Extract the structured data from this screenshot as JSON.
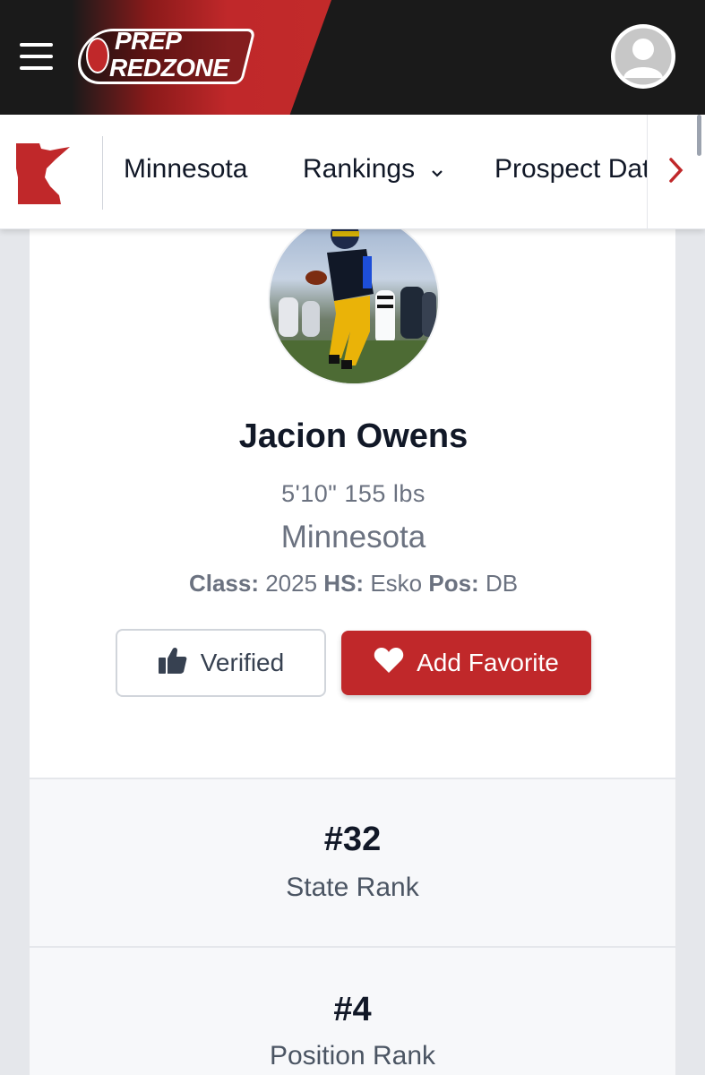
{
  "header": {
    "logo_line1": "PREP",
    "logo_line2": "REDZONE",
    "accent_color": "#c0282a",
    "menu_icon": "hamburger-menu-icon",
    "user_icon": "user-avatar-icon"
  },
  "subnav": {
    "state_icon": "minnesota-state-icon",
    "items": [
      {
        "label": "Minnesota"
      },
      {
        "label": "Rankings"
      },
      {
        "label": "Prospect Database"
      }
    ],
    "scroll_icon": "chevron-right-icon"
  },
  "profile": {
    "name": "Jacion Owens",
    "measurements": "5'10\" 155 lbs",
    "state": "Minnesota",
    "class_label": "Class:",
    "class_value": "2025",
    "hs_label": "HS:",
    "hs_value": "Esko",
    "pos_label": "Pos:",
    "pos_value": "DB"
  },
  "actions": {
    "verified_label": "Verified",
    "favorite_label": "Add Favorite"
  },
  "ranks": {
    "state": {
      "value": "#32",
      "label": "State Rank"
    },
    "position": {
      "value": "#4",
      "label": "Position Rank"
    }
  }
}
